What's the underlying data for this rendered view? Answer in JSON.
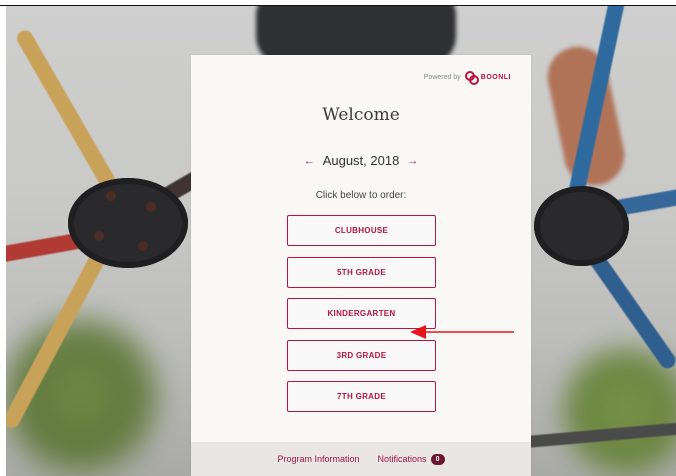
{
  "powered_by": {
    "label": "Powered by",
    "brand": "BOONLI"
  },
  "welcome": "Welcome",
  "month": {
    "label": "August, 2018",
    "prev_icon": "arrow-left-icon",
    "next_icon": "arrow-right-icon"
  },
  "instruction": "Click below to order:",
  "programs": [
    {
      "label": "CLUBHOUSE"
    },
    {
      "label": "5TH GRADE"
    },
    {
      "label": "KINDERGARTEN"
    },
    {
      "label": "3RD GRADE"
    },
    {
      "label": "7TH GRADE"
    }
  ],
  "footer": {
    "program_info": "Program Information",
    "notifications": "Notifications",
    "notifications_count": "0"
  },
  "colors": {
    "accent": "#b5163f",
    "card_bg": "#f9f8f7",
    "footer_bg": "#e9e6e5",
    "annotation": "#e5141b"
  }
}
